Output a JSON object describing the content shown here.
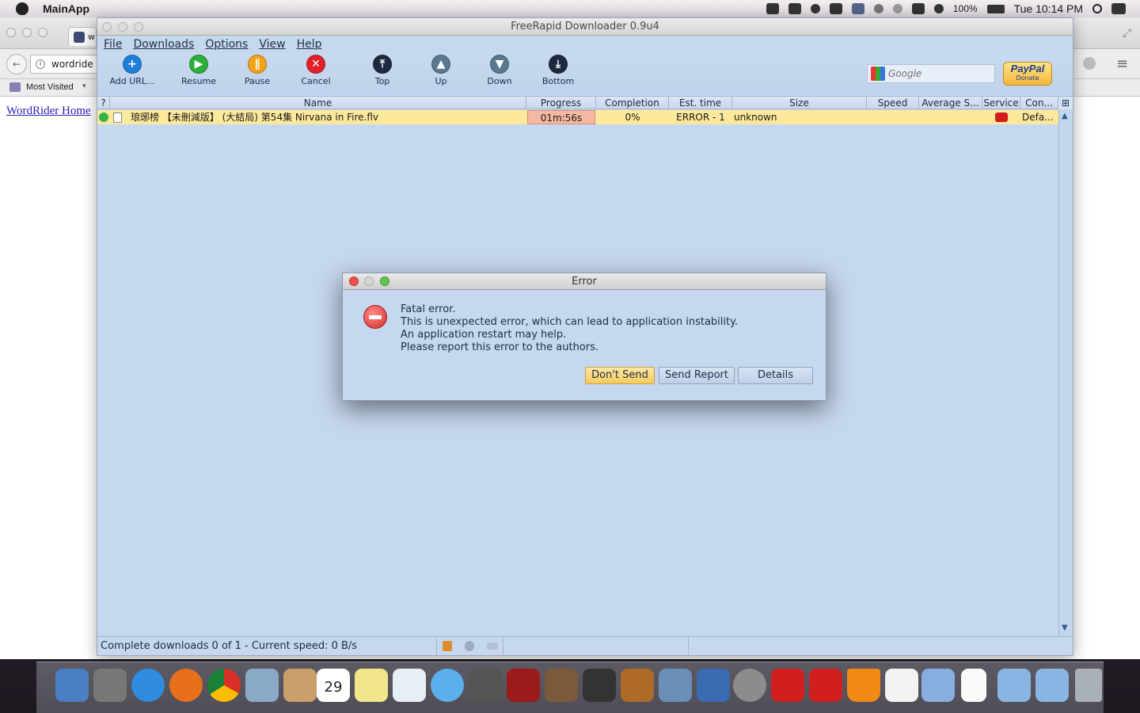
{
  "menubar": {
    "app_name": "MainApp",
    "battery": "100%",
    "clock": "Tue 10:14 PM"
  },
  "browser": {
    "tab_title_partial": "w",
    "url_partial": "wordride",
    "bookmark": "Most Visited",
    "page_link": "WordRider Home"
  },
  "app": {
    "window_title": "FreeRapid Downloader 0.9u4",
    "menus": [
      "File",
      "Downloads",
      "Options",
      "View",
      "Help"
    ],
    "toolbar": {
      "add_url": "Add URL...",
      "resume": "Resume",
      "pause": "Pause",
      "cancel": "Cancel",
      "top": "Top",
      "up": "Up",
      "down": "Down",
      "bottom": "Bottom"
    },
    "search_placeholder": "Google",
    "paypal": {
      "logo": "PayPal",
      "label": "Donate"
    },
    "table": {
      "headers": {
        "q": "?",
        "name": "Name",
        "progress": "Progress",
        "completion": "Completion",
        "est_time": "Est. time",
        "size": "Size",
        "speed": "Speed",
        "avg_speed": "Average S...",
        "service": "Service",
        "con": "Con..."
      },
      "row": {
        "name": "琅琊榜 【未刪減版】 (大結局) 第54集 Nirvana in Fire.flv",
        "progress": "01m:56s",
        "completion": "0%",
        "est_time": "ERROR - 1",
        "size": "unknown",
        "speed": "",
        "avg_speed": "",
        "con": "Defa..."
      }
    },
    "status": "Complete downloads 0 of 1 - Current speed: 0 B/s"
  },
  "dialog": {
    "title": "Error",
    "lines": [
      "Fatal error.",
      "This is unexpected error, which can lead to application instability.",
      "An application restart may help.",
      "Please report this error to the authors."
    ],
    "buttons": {
      "dont_send": "Don't Send",
      "send_report": "Send Report",
      "details": "Details"
    }
  },
  "dock": {
    "calendar_day": "29"
  },
  "colors": {
    "app_bg": "#c6d8ef",
    "selected_row": "#fde99b",
    "progress_cell": "#f5b8a0",
    "default_button": "#f6c95d"
  }
}
